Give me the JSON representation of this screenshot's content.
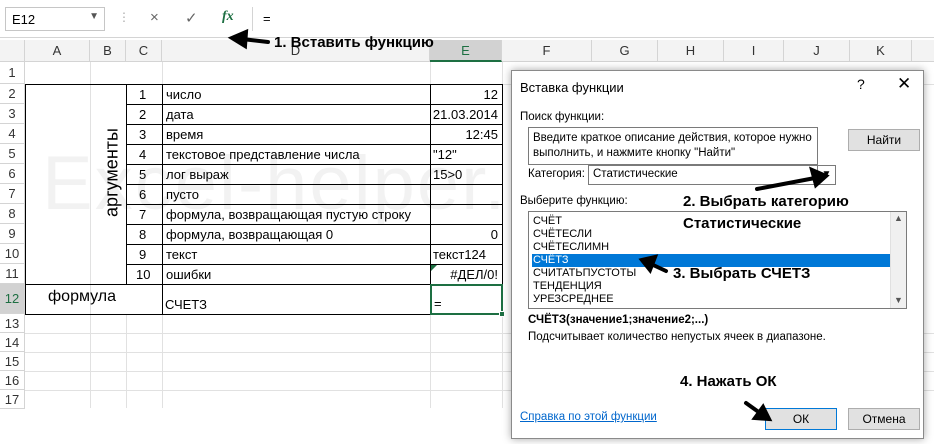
{
  "formula_bar": {
    "name_box": "E12",
    "cancel_icon": "×",
    "enter_icon": "✓",
    "fx": "fx",
    "formula": "="
  },
  "columns": [
    "A",
    "B",
    "C",
    "D",
    "E",
    "F",
    "G",
    "H",
    "I",
    "J",
    "K"
  ],
  "rows": [
    "1",
    "2",
    "3",
    "4",
    "5",
    "6",
    "7",
    "8",
    "9",
    "10",
    "11",
    "12",
    "13",
    "14",
    "15",
    "16",
    "17"
  ],
  "sheet": {
    "args_label": "аргументы",
    "formula_label": "формула",
    "formula_name": "СЧЕТЗ",
    "e12_value": "=",
    "watermark": "Excel-helper.ru",
    "table": [
      {
        "n": "1",
        "desc": "число",
        "value": "12"
      },
      {
        "n": "2",
        "desc": "дата",
        "value": "21.03.2014"
      },
      {
        "n": "3",
        "desc": "время",
        "value": "12:45"
      },
      {
        "n": "4",
        "desc": "текстовое представление числа",
        "value": "\"12\""
      },
      {
        "n": "5",
        "desc": "лог выраж",
        "value": "15>0"
      },
      {
        "n": "6",
        "desc": "пусто",
        "value": ""
      },
      {
        "n": "7",
        "desc": "формула, возвращающая пустую строку",
        "value": ""
      },
      {
        "n": "8",
        "desc": "формула, возвращающая 0",
        "value": "0"
      },
      {
        "n": "9",
        "desc": "текст",
        "value": "текст124"
      },
      {
        "n": "10",
        "desc": "ошибки",
        "value": "#ДЕЛ/0!"
      }
    ]
  },
  "dialog": {
    "title": "Вставка функции",
    "help_glyph": "?",
    "close_glyph": "✕",
    "search_label": "Поиск функции:",
    "search_text": "Введите краткое описание действия, которое нужно выполнить, и нажмите кнопку \"Найти\"",
    "find_button": "Найти",
    "category_label": "Категория:",
    "category_value": "Статистические",
    "choose_label": "Выберите функцию:",
    "functions": [
      "СЧЁТ",
      "СЧЁТЕСЛИ",
      "СЧЁТЕСЛИМН",
      "СЧЁТЗ",
      "СЧИТАТЬПУСТОТЫ",
      "ТЕНДЕНЦИЯ",
      "УРЕЗСРЕДНЕЕ"
    ],
    "selected_index": 3,
    "signature": "СЧЁТЗ(значение1;значение2;...)",
    "description": "Подсчитывает количество непустых ячеек в диапазоне.",
    "help_link": "Справка по этой функции",
    "ok_button": "ОК",
    "cancel_button": "Отмена"
  },
  "annotations": {
    "step1": "1. Вставить функцию",
    "step2a": "2. Выбрать категорию",
    "step2b": "Статистические",
    "step3": "3. Выбрать СЧЕТЗ",
    "step4": "4. Нажать ОК"
  },
  "colors": {
    "excel_green": "#1d6f42",
    "selection_blue": "#0078d7"
  }
}
